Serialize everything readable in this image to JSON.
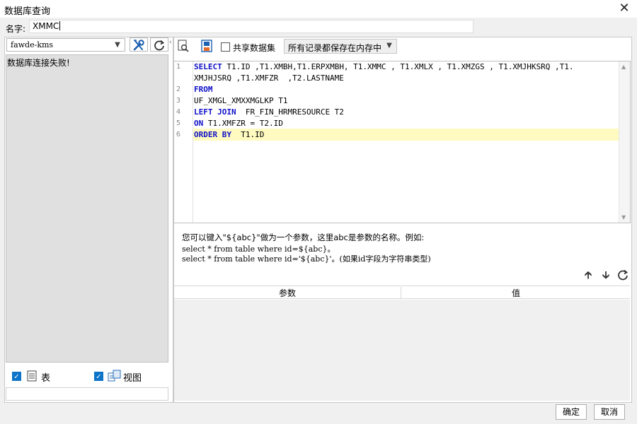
{
  "window": {
    "title": "数据库查询",
    "close_glyph": "✕"
  },
  "name": {
    "label": "名字:",
    "value": "XMMC"
  },
  "left": {
    "connection": "fawde-kms",
    "status": "数据库连接失败!",
    "tools": [
      "wrench-screwdriver-icon",
      "refresh-icon"
    ],
    "options": [
      {
        "label": "表",
        "checked": true,
        "icon": "table-icon"
      },
      {
        "label": "视图",
        "checked": true,
        "icon": "view-icon"
      }
    ]
  },
  "toolbar": {
    "share_label": "共享数据集",
    "share_checked": false,
    "memory_option": "所有记录都保存在内存中",
    "icons": [
      "preview-icon",
      "save-data-icon"
    ]
  },
  "sql_lines": [
    {
      "num": "1",
      "parts": [
        {
          "t": "SELECT",
          "k": true
        },
        {
          "t": " T1.ID ,T1.XMBH,T1.ERPXMBH, T1.XMMC , T1.XMLX , T1.XMZGS , T1.XMJHKSRQ ,T1.",
          "k": false
        }
      ]
    },
    {
      "num": "",
      "parts": [
        {
          "t": "XMJHJSRQ ,T1.XMFZR  ,T2.LASTNAME",
          "k": false
        }
      ]
    },
    {
      "num": "2",
      "parts": [
        {
          "t": "FROM",
          "k": true
        }
      ]
    },
    {
      "num": "3",
      "parts": [
        {
          "t": "UF_XMGL_XMXXMGLKP T1",
          "k": false
        }
      ]
    },
    {
      "num": "4",
      "parts": [
        {
          "t": "LEFT JOIN",
          "k": true
        },
        {
          "t": "  FR_FIN_HRMRESOURCE T2",
          "k": false
        }
      ]
    },
    {
      "num": "5",
      "parts": [
        {
          "t": "ON",
          "k": true
        },
        {
          "t": " T1.XMFZR = T2.ID",
          "k": false
        }
      ]
    },
    {
      "num": "6",
      "parts": [
        {
          "t": "ORDER BY",
          "k": true
        },
        {
          "t": "  T1.ID",
          "k": false
        }
      ]
    }
  ],
  "hint": {
    "line1": "您可以键入\"${abc}\"做为一个参数，这里abc是参数的名称。例如:",
    "line2": "select * from table where id=${abc}。",
    "line3": "select * from table where id='${abc}'。(如果id字段为字符串类型)"
  },
  "param_table": {
    "col_param": "参数",
    "col_value": "值",
    "icons": [
      "arrow-up-icon",
      "arrow-down-icon",
      "refresh-icon"
    ]
  },
  "footer": {
    "ok": "确定",
    "cancel": "取消"
  }
}
